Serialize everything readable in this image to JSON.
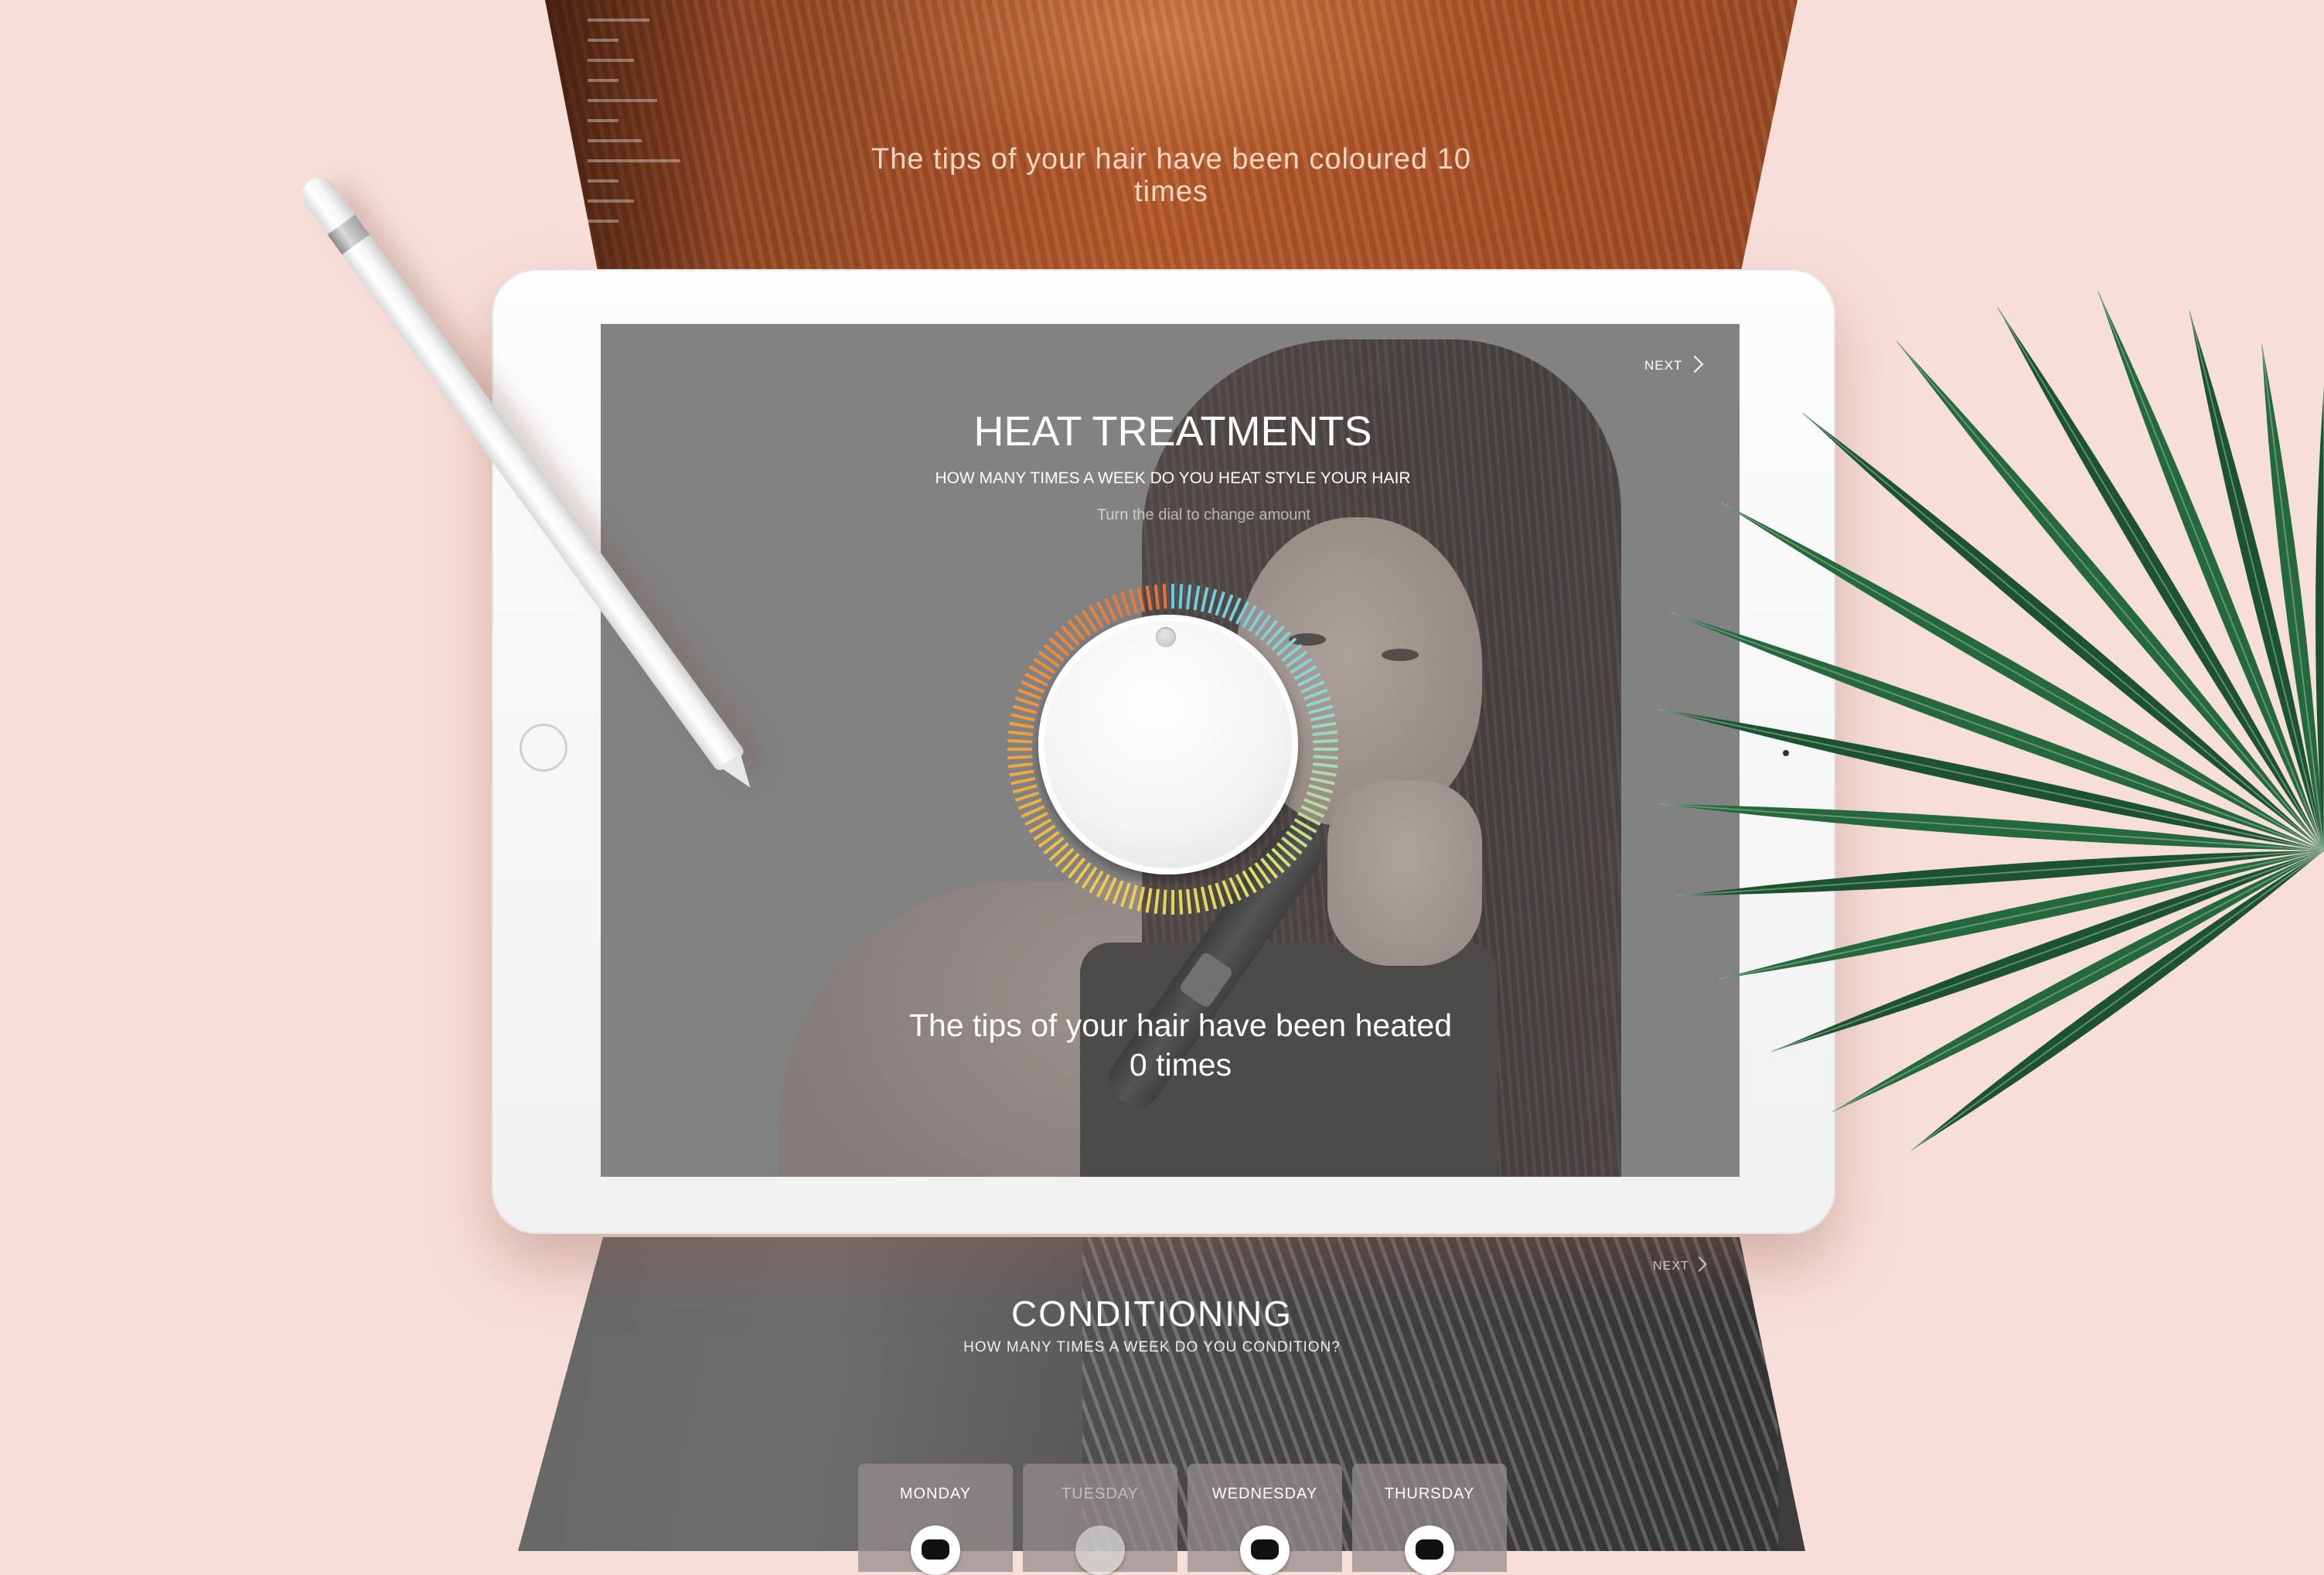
{
  "previous_screen": {
    "result_text": "The tips of your hair have been coloured 10 times"
  },
  "current_screen": {
    "next_label": "NEXT",
    "title": "HEAT TREATMENTS",
    "question": "HOW MANY TIMES A WEEK DO YOU HEAT STYLE YOUR HAIR",
    "hint": "Turn the dial to change amount",
    "result_line1": "The tips of your hair have been heated",
    "result_line2": "0 times",
    "dial": {
      "value": 0,
      "gradient_colors": [
        "#e8703a",
        "#f0963a",
        "#f2c64a",
        "#d9e06a",
        "#8fd8d0",
        "#6cc8e0"
      ]
    }
  },
  "next_screen": {
    "next_label": "NEXT",
    "title": "CONDITIONING",
    "question": "HOW MANY TIMES A WEEK DO YOU CONDITION?",
    "days": [
      {
        "label": "MONDAY",
        "selected": true
      },
      {
        "label": "TUESDAY",
        "selected": false
      },
      {
        "label": "WEDNESDAY",
        "selected": true
      },
      {
        "label": "THURSDAY",
        "selected": true
      }
    ]
  },
  "colors": {
    "background": "#f7dfd8",
    "tablet_frame": "#fdfdfd",
    "palm": "#1f5a34"
  }
}
